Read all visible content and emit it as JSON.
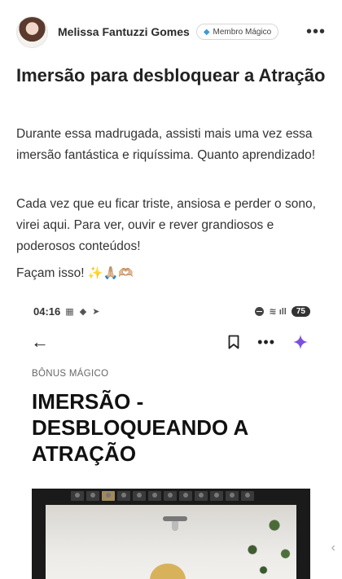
{
  "post": {
    "author": "Melissa Fantuzzi Gomes",
    "badge": "Membro Mágico",
    "title": "Imersão para desbloquear a Atração",
    "paragraphs": [
      "Durante essa madrugada, assisti mais uma vez essa imersão fantástica e riquíssima. Quanto aprendizado!",
      "Cada vez que eu ficar triste, ansiosa e perder o sono, virei aqui. Para ver, ouvir e rever grandiosos e poderosos conteúdos!",
      "Façam isso!"
    ],
    "emojis": "✨🙏🏼🫶🏼"
  },
  "screenshot": {
    "time": "04:16",
    "battery": "75",
    "kicker": "BÔNUS MÁGICO",
    "title": "IMERSÃO - DESBLOQUEANDO A ATRAÇÃO"
  },
  "icons": {
    "badge": "gem-icon",
    "more": "more-horizontal-icon",
    "back": "arrow-left-icon",
    "bookmark": "bookmark-icon",
    "sparkle": "sparkle-icon",
    "side": "chevron-left-icon"
  },
  "colors": {
    "sparkle": "#7b4fe0",
    "badge_gem": "#3a9bd8"
  }
}
